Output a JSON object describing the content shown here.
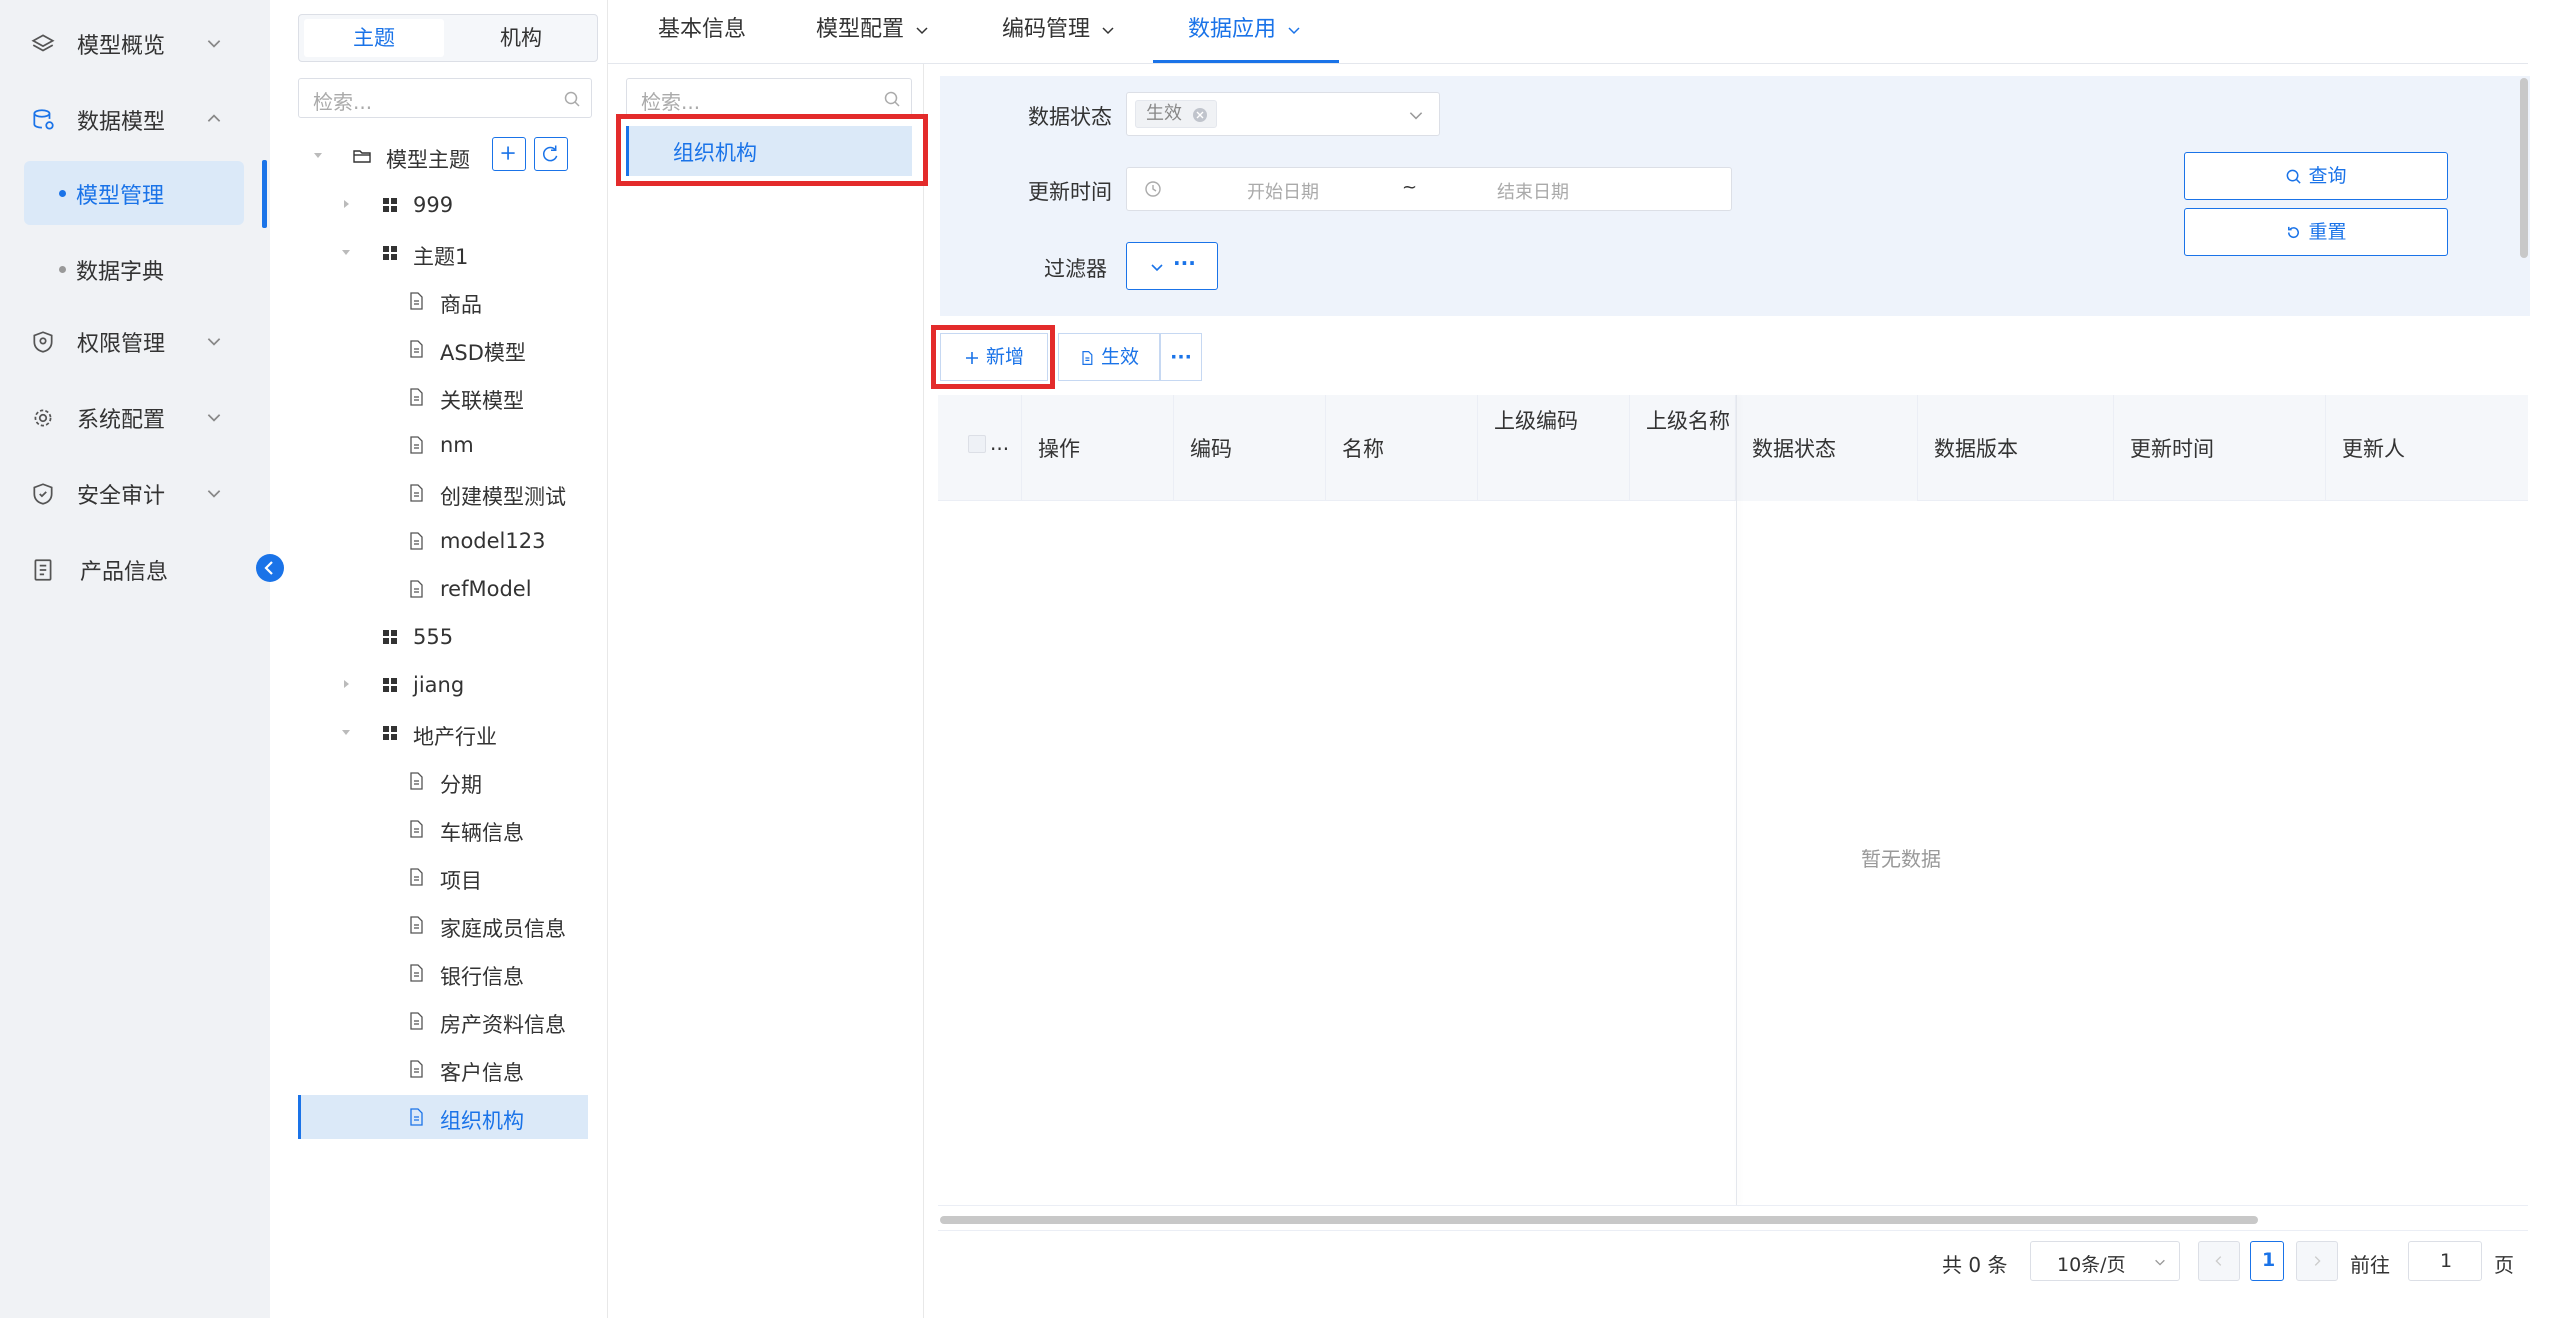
{
  "nav": {
    "items": [
      {
        "label": "模型概览",
        "icon": "layers-icon"
      },
      {
        "label": "数据模型",
        "icon": "database-icon"
      },
      {
        "label": "权限管理",
        "icon": "shield-icon"
      },
      {
        "label": "系统配置",
        "icon": "gear-icon"
      },
      {
        "label": "安全审计",
        "icon": "audit-shield-icon"
      },
      {
        "label": "产品信息",
        "icon": "document-icon"
      }
    ],
    "sub_items": [
      {
        "label": "模型管理",
        "active": true
      },
      {
        "label": "数据字典",
        "active": false
      }
    ],
    "accent_color": "#1a73e8"
  },
  "tree": {
    "tabs": [
      "主题",
      "机构"
    ],
    "active_tab": "主题",
    "search_placeholder": "检索...",
    "root_label": "模型主题",
    "nodes": [
      {
        "label": "999"
      },
      {
        "label": "主题1"
      },
      {
        "label": "商品"
      },
      {
        "label": "ASD模型"
      },
      {
        "label": "关联模型"
      },
      {
        "label": "nm"
      },
      {
        "label": "创建模型测试"
      },
      {
        "label": "model123"
      },
      {
        "label": "refModel"
      },
      {
        "label": "555"
      },
      {
        "label": "jiang"
      },
      {
        "label": "地产行业"
      },
      {
        "label": "分期"
      },
      {
        "label": "车辆信息"
      },
      {
        "label": "项目"
      },
      {
        "label": "家庭成员信息"
      },
      {
        "label": "银行信息"
      },
      {
        "label": "房产资料信息"
      },
      {
        "label": "客户信息"
      },
      {
        "label": "组织机构"
      }
    ],
    "selected": "组织机构"
  },
  "tabs": [
    {
      "label": "基本信息",
      "dropdown": false
    },
    {
      "label": "模型配置",
      "dropdown": true
    },
    {
      "label": "编码管理",
      "dropdown": true
    },
    {
      "label": "数据应用",
      "dropdown": true,
      "active": true
    }
  ],
  "mid": {
    "search_placeholder": "检索...",
    "items": [
      "组织机构"
    ]
  },
  "filter": {
    "status_label": "数据状态",
    "status_tag": "生效",
    "time_label": "更新时间",
    "start_placeholder": "开始日期",
    "range_sep": "~",
    "end_placeholder": "结束日期",
    "filter_label": "过滤器",
    "filter_more": "···",
    "query_button": "查询",
    "reset_button": "重置"
  },
  "toolbar": {
    "add_button": "新增",
    "effective_button": "生效",
    "more_button": "···"
  },
  "table": {
    "select_all": "...",
    "columns": [
      "操作",
      "编码",
      "名称",
      "上级编码",
      "上级名称",
      "数据状态",
      "数据版本",
      "更新时间",
      "更新人"
    ],
    "empty_text": "暂无数据"
  },
  "pagination": {
    "total": "共 0 条",
    "page_size": "10条/页",
    "current_page": "1",
    "goto_label": "前往",
    "goto_value": "1",
    "page_unit": "页"
  },
  "colors": {
    "accent": "#1a73e8",
    "highlight_box": "#e32b2b",
    "selected_bg": "#dbe9f8",
    "filter_bg": "#eef3fb"
  }
}
